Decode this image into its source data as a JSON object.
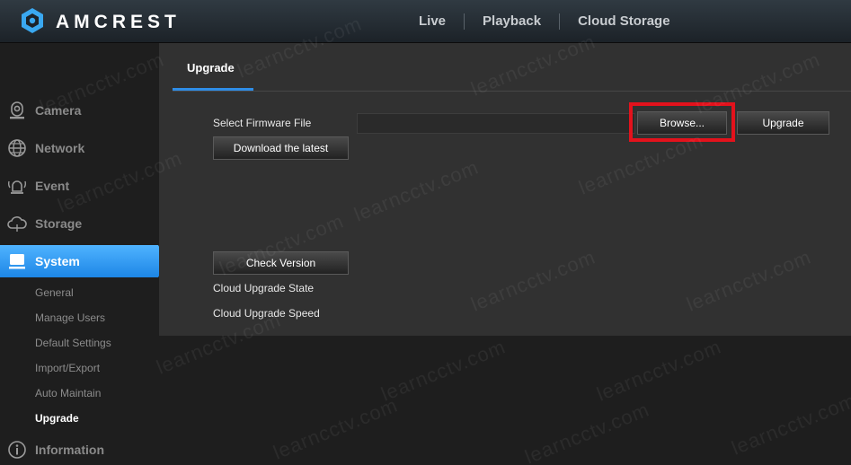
{
  "brand": {
    "name": "AMCREST"
  },
  "topnav": [
    "Live",
    "Playback",
    "Cloud Storage"
  ],
  "sidebar": {
    "items": [
      {
        "label": "Camera",
        "icon": "camera-icon"
      },
      {
        "label": "Network",
        "icon": "globe-icon"
      },
      {
        "label": "Event",
        "icon": "alarm-icon"
      },
      {
        "label": "Storage",
        "icon": "cloud-icon"
      },
      {
        "label": "System",
        "icon": "monitor-icon",
        "active": true
      },
      {
        "label": "Information",
        "icon": "info-icon"
      }
    ],
    "subitems": [
      "General",
      "Manage Users",
      "Default Settings",
      "Import/Export",
      "Auto Maintain",
      "Upgrade"
    ],
    "current_subitem": "Upgrade"
  },
  "panel": {
    "tab_label": "Upgrade",
    "select_firmware_label": "Select Firmware File",
    "firmware_value": "",
    "browse_label": "Browse...",
    "upgrade_label": "Upgrade",
    "download_latest_label": "Download the latest",
    "check_version_label": "Check Version",
    "cloud_upgrade_state_label": "Cloud Upgrade State",
    "cloud_upgrade_speed_label": "Cloud Upgrade Speed"
  },
  "watermark": "learncctv.com",
  "colors": {
    "accent": "#2e8de6",
    "active_item": "#1d86e6",
    "highlight": "#e3121c",
    "panel": "#313131",
    "background": "#1e1e1e"
  }
}
